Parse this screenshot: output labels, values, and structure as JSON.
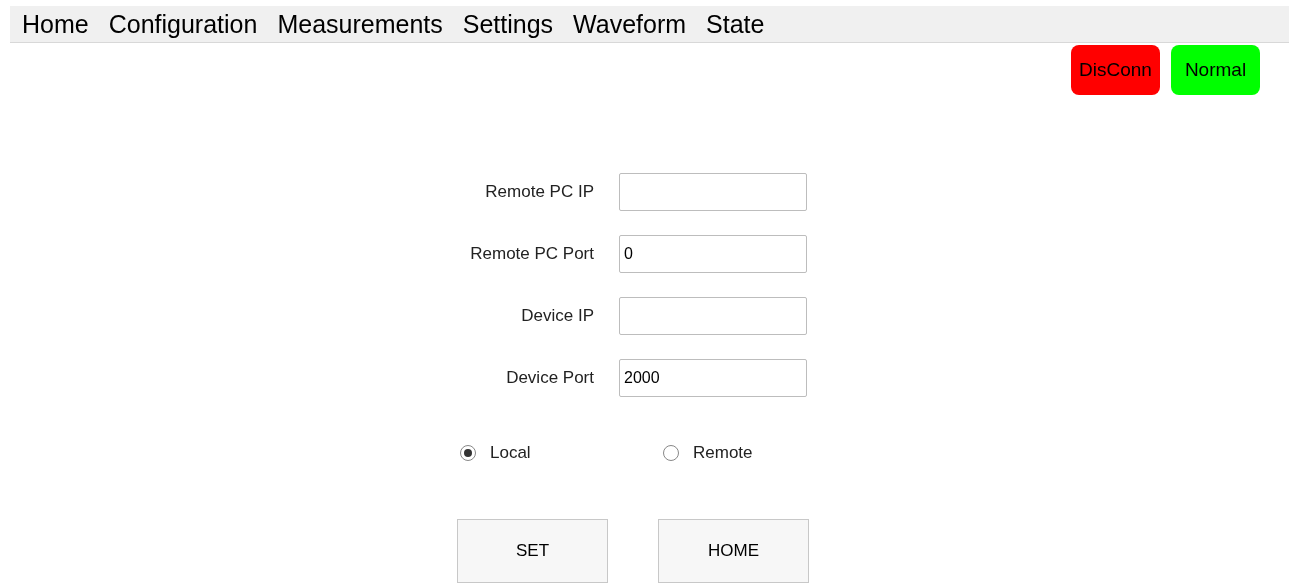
{
  "menu": [
    {
      "label": "Home"
    },
    {
      "label": "Configuration"
    },
    {
      "label": "Measurements"
    },
    {
      "label": "Settings"
    },
    {
      "label": "Waveform"
    },
    {
      "label": "State"
    }
  ],
  "status": [
    {
      "label": "DisConn",
      "color": "#ff0000"
    },
    {
      "label": "Normal",
      "color": "#00ff00"
    }
  ],
  "fields": [
    {
      "label": "Remote PC IP"
    },
    {
      "label": "Remote PC Port",
      "value": "0"
    },
    {
      "label": "Device IP"
    },
    {
      "label": "Device Port",
      "value": "2000"
    }
  ],
  "mode": [
    {
      "label": "Local",
      "selected": true
    },
    {
      "label": "Remote",
      "selected": false
    }
  ],
  "buttons": [
    {
      "label": "SET"
    },
    {
      "label": "HOME"
    }
  ]
}
